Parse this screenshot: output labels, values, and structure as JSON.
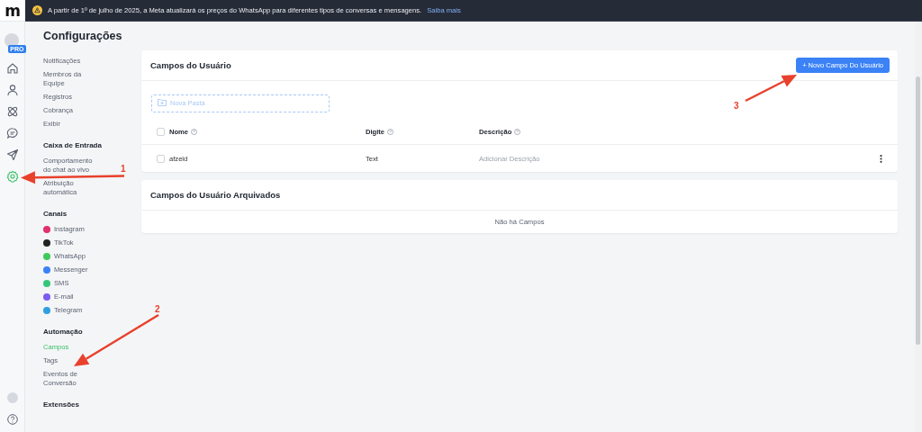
{
  "logo": "m",
  "rail": {
    "badge": "PRO",
    "items": [
      {
        "kind": "home",
        "selected": false
      },
      {
        "kind": "user",
        "selected": false
      },
      {
        "kind": "atom",
        "selected": false
      },
      {
        "kind": "chat",
        "selected": false
      },
      {
        "kind": "send",
        "selected": false
      },
      {
        "kind": "gear",
        "selected": true
      }
    ]
  },
  "banner": {
    "text": "A partir de 1º de julho de 2025, a Meta atualizará os preços do WhatsApp para diferentes tipos de conversas e mensagens.",
    "link": "Saiba mais"
  },
  "page_title": "Configurações",
  "nav": {
    "sections": [
      {
        "items": [
          {
            "label": "Notificações",
            "selected": false
          },
          {
            "label": "Membros da Equipe",
            "selected": false
          },
          {
            "label": "Registros",
            "selected": false
          },
          {
            "label": "Cobrança",
            "selected": false
          },
          {
            "label": "Exibir",
            "selected": false
          }
        ]
      },
      {
        "title": "Caixa de Entrada",
        "items": [
          {
            "label": "Comportamento do chat ao vivo",
            "selected": false
          },
          {
            "label": "Atribuição automática",
            "selected": false
          }
        ]
      },
      {
        "title": "Canais",
        "items": [
          {
            "label": "Instagram",
            "selected": false,
            "color": "#e1306c"
          },
          {
            "label": "TikTok",
            "selected": false,
            "color": "#222222"
          },
          {
            "label": "WhatsApp",
            "selected": false,
            "color": "#3ec95c"
          },
          {
            "label": "Messenger",
            "selected": false,
            "color": "#3b82f6"
          },
          {
            "label": "SMS",
            "selected": false,
            "color": "#34c77b"
          },
          {
            "label": "E-mail",
            "selected": false,
            "color": "#7c5cf0"
          },
          {
            "label": "Telegram",
            "selected": false,
            "color": "#2f9fe0"
          }
        ]
      },
      {
        "title": "Automação",
        "items": [
          {
            "label": "Campos",
            "selected": true
          },
          {
            "label": "Tags",
            "selected": false
          },
          {
            "label": "Eventos de Conversão",
            "selected": false
          }
        ]
      },
      {
        "title": "Extensões"
      }
    ]
  },
  "fields": {
    "title": "Campos do Usuário",
    "button": "+ Novo Campo Do Usuário",
    "folder_placeholder": "Nova Pasta",
    "header_checked": false,
    "columns": [
      "Nome",
      "Digite",
      "Descrição"
    ],
    "rows": [
      {
        "checked": false,
        "name": "afzeld",
        "type": "Text",
        "description_placeholder": "Adicionar Descrição"
      }
    ]
  },
  "archived": {
    "title": "Campos do Usuário Arquivados",
    "empty": "Não há Campos"
  },
  "annotations": [
    {
      "label": "1"
    },
    {
      "label": "2"
    },
    {
      "label": "3"
    }
  ]
}
